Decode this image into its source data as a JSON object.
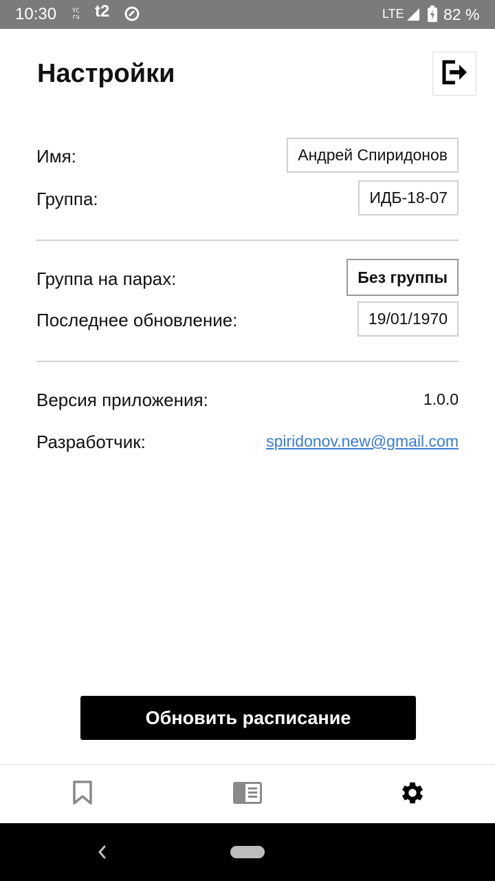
{
  "status_bar": {
    "time": "10:30",
    "icon_yc_top": "YC",
    "icon_yc_bottom": "ru",
    "carrier": "t2",
    "network": "LTE",
    "battery_percent": "82 %"
  },
  "header": {
    "title": "Настройки"
  },
  "profile": {
    "name_label": "Имя:",
    "name_value": "Андрей Спиридонов",
    "group_label": "Группа:",
    "group_value": "ИДБ-18-07"
  },
  "schedule": {
    "subgroup_label": "Группа на парах:",
    "subgroup_value": "Без группы",
    "last_update_label": "Последнее обновление:",
    "last_update_value": "19/01/1970"
  },
  "about": {
    "version_label": "Версия приложения:",
    "version_value": "1.0.0",
    "developer_label": "Разработчик:",
    "developer_email": "spiridonov.new@gmail.com"
  },
  "actions": {
    "refresh_label": "Обновить расписание"
  },
  "bottom_nav": {
    "items": [
      {
        "icon": "bookmark-icon",
        "active": false
      },
      {
        "icon": "schedule-icon",
        "active": false
      },
      {
        "icon": "gear-icon",
        "active": true
      }
    ]
  },
  "colors": {
    "status_bar": "#7b7b7b",
    "link": "#3a7bd5",
    "button_bg": "#000000",
    "inactive_icon": "#8a8a8a"
  }
}
